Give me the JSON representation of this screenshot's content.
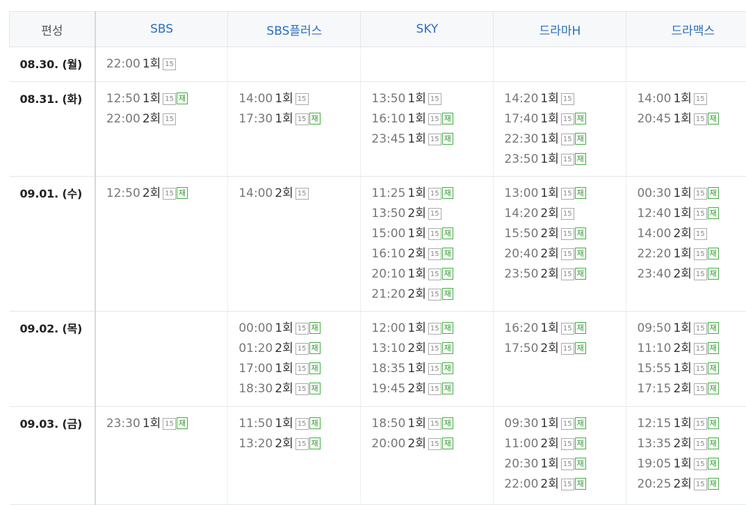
{
  "header": {
    "date_col": "편성",
    "channels": [
      "SBS",
      "SBS플러스",
      "SKY",
      "드라마H",
      "드라맥스"
    ]
  },
  "rows": [
    {
      "date": "08.30. (월)",
      "cells": [
        [
          {
            "time": "22:00",
            "ep": "1회",
            "rating": "15",
            "re": ""
          }
        ],
        [],
        [],
        [],
        []
      ]
    },
    {
      "date": "08.31. (화)",
      "cells": [
        [
          {
            "time": "12:50",
            "ep": "1회",
            "rating": "15",
            "re": "재"
          },
          {
            "time": "22:00",
            "ep": "2회",
            "rating": "15",
            "re": ""
          }
        ],
        [
          {
            "time": "14:00",
            "ep": "1회",
            "rating": "15",
            "re": ""
          },
          {
            "time": "17:30",
            "ep": "1회",
            "rating": "15",
            "re": "재"
          }
        ],
        [
          {
            "time": "13:50",
            "ep": "1회",
            "rating": "15",
            "re": ""
          },
          {
            "time": "16:10",
            "ep": "1회",
            "rating": "15",
            "re": "재"
          },
          {
            "time": "23:45",
            "ep": "1회",
            "rating": "15",
            "re": "재"
          }
        ],
        [
          {
            "time": "14:20",
            "ep": "1회",
            "rating": "15",
            "re": ""
          },
          {
            "time": "17:40",
            "ep": "1회",
            "rating": "15",
            "re": "재"
          },
          {
            "time": "22:30",
            "ep": "1회",
            "rating": "15",
            "re": "재"
          },
          {
            "time": "23:50",
            "ep": "1회",
            "rating": "15",
            "re": "재"
          }
        ],
        [
          {
            "time": "14:00",
            "ep": "1회",
            "rating": "15",
            "re": ""
          },
          {
            "time": "20:45",
            "ep": "1회",
            "rating": "15",
            "re": "재"
          }
        ]
      ]
    },
    {
      "date": "09.01. (수)",
      "cells": [
        [
          {
            "time": "12:50",
            "ep": "2회",
            "rating": "15",
            "re": "재"
          }
        ],
        [
          {
            "time": "14:00",
            "ep": "2회",
            "rating": "15",
            "re": ""
          }
        ],
        [
          {
            "time": "11:25",
            "ep": "1회",
            "rating": "15",
            "re": "재"
          },
          {
            "time": "13:50",
            "ep": "2회",
            "rating": "15",
            "re": ""
          },
          {
            "time": "15:00",
            "ep": "1회",
            "rating": "15",
            "re": "재"
          },
          {
            "time": "16:10",
            "ep": "2회",
            "rating": "15",
            "re": "재"
          },
          {
            "time": "20:10",
            "ep": "1회",
            "rating": "15",
            "re": "재"
          },
          {
            "time": "21:20",
            "ep": "2회",
            "rating": "15",
            "re": "재"
          }
        ],
        [
          {
            "time": "13:00",
            "ep": "1회",
            "rating": "15",
            "re": "재"
          },
          {
            "time": "14:20",
            "ep": "2회",
            "rating": "15",
            "re": ""
          },
          {
            "time": "15:50",
            "ep": "2회",
            "rating": "15",
            "re": "재"
          },
          {
            "time": "20:40",
            "ep": "2회",
            "rating": "15",
            "re": "재"
          },
          {
            "time": "23:50",
            "ep": "2회",
            "rating": "15",
            "re": "재"
          }
        ],
        [
          {
            "time": "00:30",
            "ep": "1회",
            "rating": "15",
            "re": "재"
          },
          {
            "time": "12:40",
            "ep": "1회",
            "rating": "15",
            "re": "재"
          },
          {
            "time": "14:00",
            "ep": "2회",
            "rating": "15",
            "re": ""
          },
          {
            "time": "22:20",
            "ep": "1회",
            "rating": "15",
            "re": "재"
          },
          {
            "time": "23:40",
            "ep": "2회",
            "rating": "15",
            "re": "재"
          }
        ]
      ]
    },
    {
      "date": "09.02. (목)",
      "cells": [
        [],
        [
          {
            "time": "00:00",
            "ep": "1회",
            "rating": "15",
            "re": "재"
          },
          {
            "time": "01:20",
            "ep": "2회",
            "rating": "15",
            "re": "재"
          },
          {
            "time": "17:00",
            "ep": "1회",
            "rating": "15",
            "re": "재"
          },
          {
            "time": "18:30",
            "ep": "2회",
            "rating": "15",
            "re": "재"
          }
        ],
        [
          {
            "time": "12:00",
            "ep": "1회",
            "rating": "15",
            "re": "재"
          },
          {
            "time": "13:10",
            "ep": "2회",
            "rating": "15",
            "re": "재"
          },
          {
            "time": "18:35",
            "ep": "1회",
            "rating": "15",
            "re": "재"
          },
          {
            "time": "19:45",
            "ep": "2회",
            "rating": "15",
            "re": "재"
          }
        ],
        [
          {
            "time": "16:20",
            "ep": "1회",
            "rating": "15",
            "re": "재"
          },
          {
            "time": "17:50",
            "ep": "2회",
            "rating": "15",
            "re": "재"
          }
        ],
        [
          {
            "time": "09:50",
            "ep": "1회",
            "rating": "15",
            "re": "재"
          },
          {
            "time": "11:10",
            "ep": "2회",
            "rating": "15",
            "re": "재"
          },
          {
            "time": "15:55",
            "ep": "1회",
            "rating": "15",
            "re": "재"
          },
          {
            "time": "17:15",
            "ep": "2회",
            "rating": "15",
            "re": "재"
          }
        ]
      ]
    },
    {
      "date": "09.03. (금)",
      "cells": [
        [
          {
            "time": "23:30",
            "ep": "1회",
            "rating": "15",
            "re": "재"
          }
        ],
        [
          {
            "time": "11:50",
            "ep": "1회",
            "rating": "15",
            "re": "재"
          },
          {
            "time": "13:20",
            "ep": "2회",
            "rating": "15",
            "re": "재"
          }
        ],
        [
          {
            "time": "18:50",
            "ep": "1회",
            "rating": "15",
            "re": "재"
          },
          {
            "time": "20:00",
            "ep": "2회",
            "rating": "15",
            "re": "재"
          }
        ],
        [
          {
            "time": "09:30",
            "ep": "1회",
            "rating": "15",
            "re": "재"
          },
          {
            "time": "11:00",
            "ep": "2회",
            "rating": "15",
            "re": "재"
          },
          {
            "time": "20:30",
            "ep": "1회",
            "rating": "15",
            "re": "재"
          },
          {
            "time": "22:00",
            "ep": "2회",
            "rating": "15",
            "re": "재"
          }
        ],
        [
          {
            "time": "12:15",
            "ep": "1회",
            "rating": "15",
            "re": "재"
          },
          {
            "time": "13:35",
            "ep": "2회",
            "rating": "15",
            "re": "재"
          },
          {
            "time": "19:05",
            "ep": "1회",
            "rating": "15",
            "re": "재"
          },
          {
            "time": "20:25",
            "ep": "2회",
            "rating": "15",
            "re": "재"
          }
        ]
      ]
    }
  ],
  "colors": {
    "channel_link": "#2a6dc5",
    "rerun_badge": "#3fae3f",
    "rating_badge": "#aaaaaa",
    "header_bg": "#f7f8fa"
  }
}
